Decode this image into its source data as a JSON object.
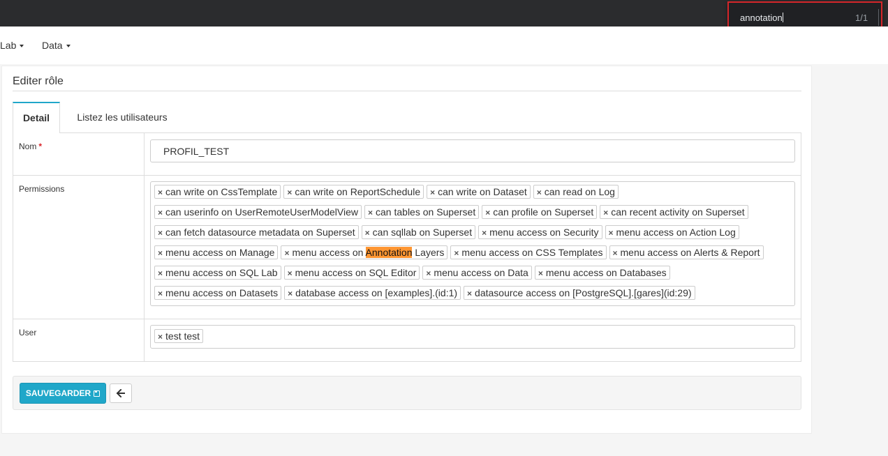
{
  "find_bar": {
    "query": "annotation",
    "match_count": "1/1"
  },
  "nav": {
    "items": [
      "Lab",
      "Data"
    ]
  },
  "page": {
    "title": "Editer rôle"
  },
  "tabs": {
    "detail": "Detail",
    "users": "Listez les utilisateurs"
  },
  "form": {
    "name_label": "Nom",
    "required_marker": "*",
    "name_value": "PROFIL_TEST",
    "permissions_label": "Permissions",
    "permissions": [
      [
        "can write on CssTemplate",
        "can write on ReportSchedule",
        "can write on Dataset",
        "can read on Log"
      ],
      [
        "can userinfo on UserRemoteUserModelView",
        "can tables on Superset",
        "can profile on Superset",
        "can recent activity on Superset"
      ],
      [
        "can fetch datasource metadata on Superset",
        "can sqllab on Superset",
        "menu access on Security",
        "menu access on Action Log"
      ],
      [
        "menu access on Manage",
        "menu access on Annotation Layers",
        "menu access on CSS Templates",
        "menu access on Alerts & Report"
      ],
      [
        "menu access on SQL Lab",
        "menu access on SQL Editor",
        "menu access on Data",
        "menu access on Databases"
      ],
      [
        "menu access on Datasets",
        "database access on [examples].(id:1)",
        "datasource access on [PostgreSQL].[gares](id:29)"
      ]
    ],
    "user_label": "User",
    "users": [
      "test test"
    ],
    "tag_remove_glyph": "×"
  },
  "actions": {
    "save_label": "SAUVEGARDER",
    "back_icon": "arrow-left-icon",
    "save_icon": "floppy-disk-icon"
  },
  "colors": {
    "accent": "#20a7c9",
    "find_highlight": "#ff9632",
    "find_border": "#d6262a"
  }
}
